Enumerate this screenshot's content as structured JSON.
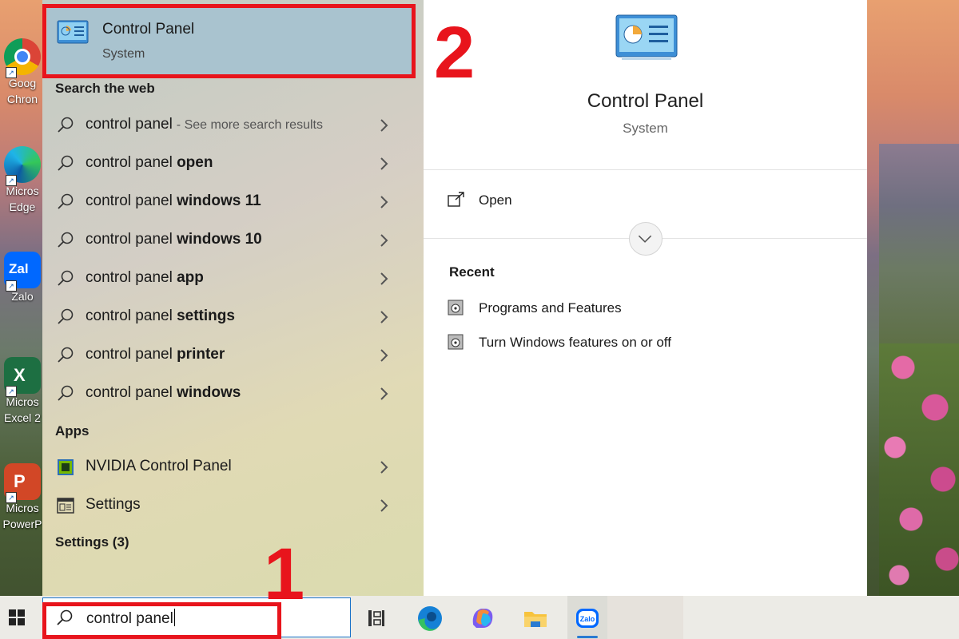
{
  "desktop": {
    "icons": [
      {
        "label": "Goog\nChron",
        "icon": "chrome-icon"
      },
      {
        "label": "Micros\nEdge",
        "icon": "edge-icon"
      },
      {
        "label": "Zalo",
        "icon": "zalo-icon"
      },
      {
        "label": "Micros\nExcel 2",
        "icon": "excel-icon"
      },
      {
        "label": "Micros\nPowerP",
        "icon": "powerpoint-icon"
      }
    ]
  },
  "start_menu": {
    "best_match": {
      "title": "Control Panel",
      "subtitle": "System"
    },
    "sections": {
      "web": "Search the web",
      "apps": "Apps",
      "settings": "Settings (3)"
    },
    "web_results": [
      {
        "base": "control panel",
        "bold": "",
        "suffix": "- See more search results"
      },
      {
        "base": "control panel ",
        "bold": "open",
        "suffix": ""
      },
      {
        "base": "control panel ",
        "bold": "windows 11",
        "suffix": ""
      },
      {
        "base": "control panel ",
        "bold": "windows 10",
        "suffix": ""
      },
      {
        "base": "control panel ",
        "bold": "app",
        "suffix": ""
      },
      {
        "base": "control panel ",
        "bold": "settings",
        "suffix": ""
      },
      {
        "base": "control panel ",
        "bold": "printer",
        "suffix": ""
      },
      {
        "base": "control panel ",
        "bold": "windows",
        "suffix": ""
      }
    ],
    "apps": [
      {
        "label": "NVIDIA Control Panel",
        "icon": "nvidia-icon"
      },
      {
        "label": "Settings",
        "icon": "settings-icon"
      }
    ],
    "detail": {
      "title": "Control Panel",
      "subtitle": "System",
      "open_label": "Open",
      "recent_header": "Recent",
      "recent": [
        "Programs and Features",
        "Turn Windows features on or off"
      ]
    }
  },
  "taskbar": {
    "search_value": "control panel",
    "pinned": [
      "task-view-icon",
      "edge-icon",
      "copilot-icon",
      "file-explorer-icon",
      "zalo-icon"
    ],
    "active": "zalo-icon"
  },
  "annotations": {
    "step1": "1",
    "step2": "2"
  },
  "colors": {
    "annotation_red": "#e8141c",
    "selection": "#a9c3cf",
    "accent": "#1a73c8"
  }
}
